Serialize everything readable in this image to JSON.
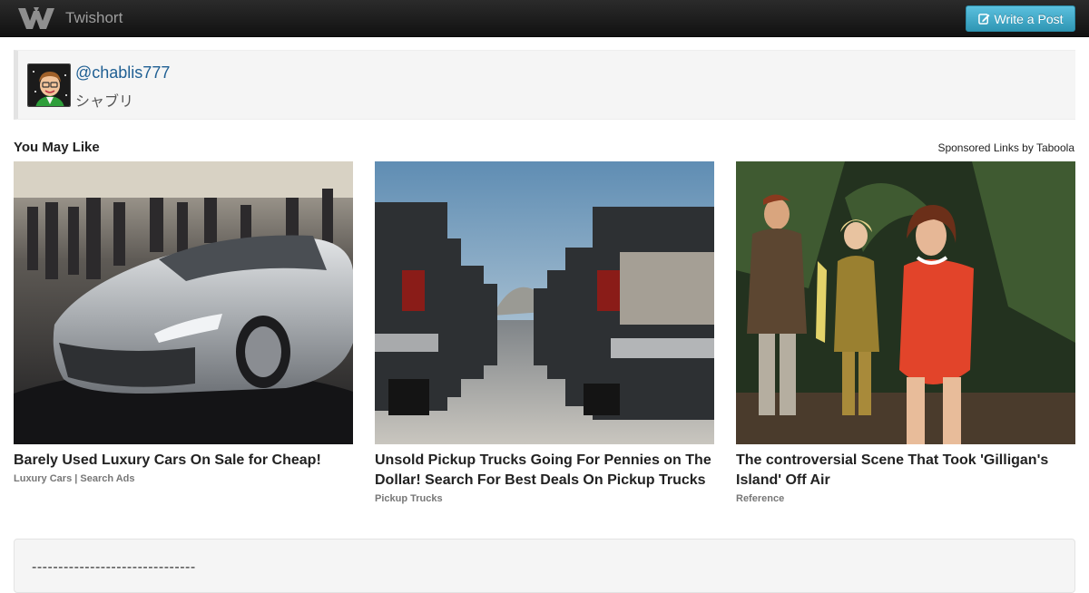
{
  "navbar": {
    "brand": "Twishort",
    "write_button": "Write a Post"
  },
  "profile": {
    "handle": "@chablis777",
    "display_name": "シャブリ"
  },
  "recommendations": {
    "title": "You May Like",
    "sponsored_label": "Sponsored Links by Taboola",
    "items": [
      {
        "title": "Barely Used Luxury Cars On Sale for Cheap!",
        "source": "Luxury Cars | Search Ads"
      },
      {
        "title": "Unsold Pickup Trucks Going For Pennies on The Dollar! Search For Best Deals On Pickup Trucks",
        "source": "Pickup Trucks"
      },
      {
        "title": "The controversial Scene That Took 'Gilligan's Island' Off Air",
        "source": "Reference"
      }
    ]
  },
  "post": {
    "text": "-------------------------------"
  },
  "colors": {
    "navbar": "#1b1b1b",
    "button": "#49afcd",
    "link": "#1f5f93"
  }
}
